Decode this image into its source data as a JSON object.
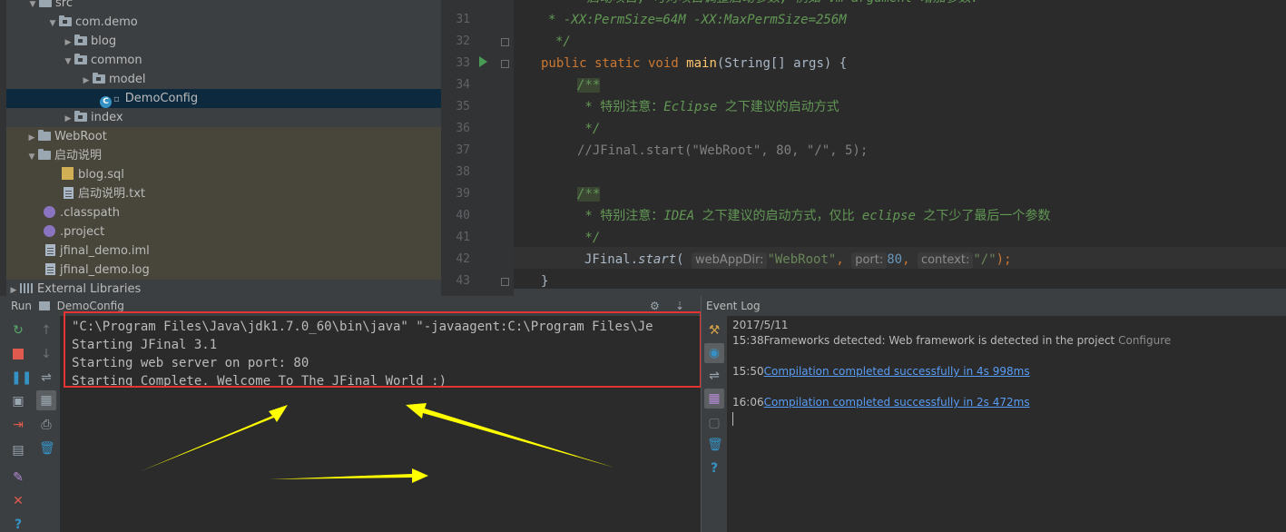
{
  "project_tree": {
    "items": [
      {
        "label": "src",
        "indent": 40,
        "arrow": "▼",
        "icon": "folder"
      },
      {
        "label": "com.demo",
        "indent": 52,
        "arrow": "▼",
        "icon": "package"
      },
      {
        "label": "blog",
        "indent": 68,
        "arrow": "▶",
        "icon": "package"
      },
      {
        "label": "common",
        "indent": 68,
        "arrow": "▼",
        "icon": "package"
      },
      {
        "label": "model",
        "indent": 88,
        "arrow": "▶",
        "icon": "package"
      },
      {
        "label": "DemoConfig",
        "indent": 108,
        "arrow": "",
        "icon": "java-class"
      },
      {
        "label": "index",
        "indent": 68,
        "arrow": "▶",
        "icon": "package"
      },
      {
        "label": "WebRoot",
        "indent": 28,
        "arrow": "▶",
        "icon": "folder"
      },
      {
        "label": "启动说明",
        "indent": 28,
        "arrow": "▼",
        "icon": "folder"
      },
      {
        "label": "blog.sql",
        "indent": 68,
        "arrow": "",
        "icon": "sql-file"
      },
      {
        "label": "启动说明.txt",
        "indent": 68,
        "arrow": "",
        "icon": "text-file"
      },
      {
        "label": ".classpath",
        "indent": 48,
        "arrow": "",
        "icon": "config-file"
      },
      {
        "label": ".project",
        "indent": 48,
        "arrow": "",
        "icon": "config-file"
      },
      {
        "label": "jfinal_demo.iml",
        "indent": 48,
        "arrow": "",
        "icon": "module-file"
      },
      {
        "label": "jfinal_demo.log",
        "indent": 48,
        "arrow": "",
        "icon": "text-file"
      },
      {
        "label": "External Libraries",
        "indent": 8,
        "arrow": "▶",
        "icon": "libraries"
      }
    ]
  },
  "editor": {
    "line_numbers": [
      "31",
      "32",
      "33",
      "34",
      "35",
      "36",
      "37",
      "38",
      "39",
      "40",
      "41",
      "42",
      "43"
    ],
    "code": {
      "l30": "    * 启动项目, 可对项目调整启动参数, 例如 vm argument 增加参数:",
      "l31": "* -XX:PermSize=64M -XX:MaxPermSize=256M",
      "l32": "*/",
      "l33_kw": "public static void ",
      "l33_fn": "main",
      "l33_rest": "(String[] args) {",
      "l34": "/**",
      "l35_a": " * 特别注意：",
      "l35_b": "Eclipse",
      "l35_c": " 之下建议的启动方式",
      "l36": " */",
      "l37": "//JFinal.start(\"WebRoot\", 80, \"/\", 5);",
      "l39": "/**",
      "l40_a": " * 特别注意：",
      "l40_b": "IDEA",
      "l40_c": " 之下建议的启动方式，仅比 ",
      "l40_d": "eclipse",
      "l40_e": " 之下少了最后一个参数",
      "l41": " */",
      "l42_a": "JFinal.",
      "l42_b": "start",
      "l42_c": "(",
      "l42_hint1": "webAppDir:",
      "l42_str1": "\"WebRoot\"",
      "l42_comma1": ",",
      "l42_hint2": "port:",
      "l42_num": "80",
      "l42_comma2": ",",
      "l42_hint3": "context:",
      "l42_str2": "\"/\"",
      "l42_end": ");",
      "l43": "}"
    }
  },
  "run_panel": {
    "tab_label": "Run",
    "config_label": "DemoConfig",
    "console_lines": [
      "\"C:\\Program Files\\Java\\jdk1.7.0_60\\bin\\java\" \"-javaagent:C:\\Program Files\\Je",
      "Starting JFinal 3.1",
      "Starting web server on port: 80",
      "Starting Complete. Welcome To The JFinal World :)"
    ],
    "annotation_color": "#e53333",
    "arrow_color": "#ffff00"
  },
  "event_log": {
    "title": "Event Log",
    "date": "2017/5/11",
    "entries": [
      {
        "time": "15:38",
        "text": "Frameworks detected: Web framework is detected in the project",
        "action": "Configure"
      },
      {
        "time": "15:50",
        "link": "Compilation completed successfully in 4s 998ms"
      },
      {
        "time": "16:06",
        "link": "Compilation completed successfully in 2s 472ms"
      }
    ]
  },
  "colors": {
    "keyword": "#cc7832",
    "function": "#ffc66d",
    "string": "#6a8759",
    "number": "#6897bb",
    "doc_comment": "#629755",
    "link": "#589df6"
  }
}
